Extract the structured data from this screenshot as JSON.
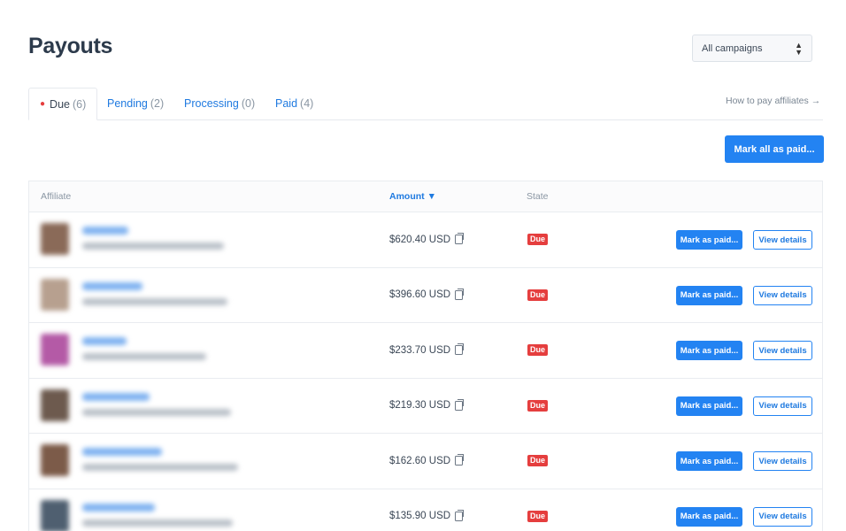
{
  "page": {
    "title": "Payouts"
  },
  "campaign_filter": {
    "selected": "All campaigns"
  },
  "tabs": [
    {
      "label": "Due",
      "count": "(6)",
      "active": true
    },
    {
      "label": "Pending",
      "count": "(2)"
    },
    {
      "label": "Processing",
      "count": "(0)"
    },
    {
      "label": "Paid",
      "count": "(4)"
    }
  ],
  "help_link": "How to pay affiliates →",
  "mark_all_label": "Mark all as paid...",
  "table": {
    "headers": {
      "affiliate": "Affiliate",
      "amount": "Amount ▼",
      "state": "State"
    },
    "rows": [
      {
        "amount": "$620.40 USD",
        "state": "Due",
        "avatar_color": "#8a6a58"
      },
      {
        "amount": "$396.60 USD",
        "state": "Due",
        "avatar_color": "#b7a08f"
      },
      {
        "amount": "$233.70 USD",
        "state": "Due",
        "avatar_color": "#b45aa6"
      },
      {
        "amount": "$219.30 USD",
        "state": "Due",
        "avatar_color": "#6d5a4e"
      },
      {
        "amount": "$162.60 USD",
        "state": "Due",
        "avatar_color": "#7c5b49"
      },
      {
        "amount": "$135.90 USD",
        "state": "Due",
        "avatar_color": "#4f5f70"
      }
    ],
    "mark_paid_label": "Mark as paid...",
    "view_details_label": "View details"
  },
  "colors": {
    "accent": "#2383f2",
    "due_badge": "#e53e3e"
  }
}
